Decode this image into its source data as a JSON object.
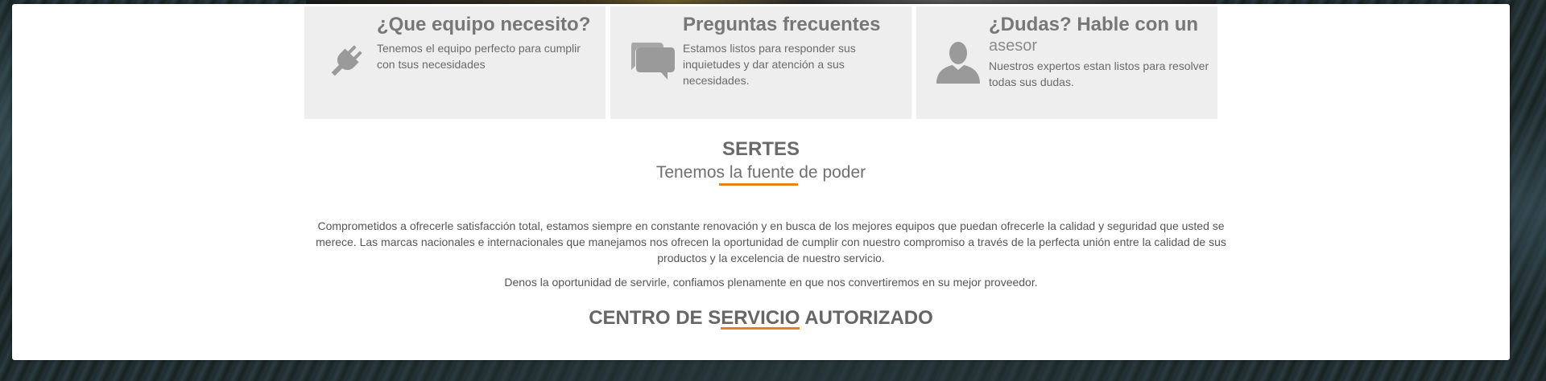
{
  "features": [
    {
      "icon": "plug-icon",
      "title": "¿Que equipo necesito?",
      "title_extra": "",
      "text": "Tenemos el equipo perfecto para cumplir con tsus necesidades"
    },
    {
      "icon": "chat-bubbles-icon",
      "title": "Preguntas frecuentes",
      "title_extra": "",
      "text": "Estamos listos para responder sus inquietudes y dar atención a sus necesidades."
    },
    {
      "icon": "user-icon",
      "title": "¿Dudas? Hable con un",
      "title_extra": "asesor",
      "text": "Nuestros expertos estan listos para resolver todas sus dudas."
    }
  ],
  "brand": {
    "title": "SERTES",
    "subtitle": "Tenemos la fuente de poder"
  },
  "about": {
    "paragraph1": "Comprometidos a ofrecerle satisfacción total, estamos siempre en constante renovación y en busca de los mejores equipos que puedan ofrecerle la calidad y seguridad que usted se merece. Las marcas nacionales e internacionales que manejamos nos ofrecen la oportunidad de cumplir con nuestro compromiso a través de la perfecta unión entre la calidad de sus productos y la excelencia de nuestro servicio.",
    "paragraph2": "Denos la oportunidad de servirle, confiamos plenamente en que nos convertiremos en su mejor proveedor."
  },
  "service": {
    "title": "CENTRO DE SERVICIO AUTORIZADO"
  },
  "colors": {
    "accent": "#e8801e",
    "card_bg": "#eeeeee",
    "icon": "#999999"
  }
}
